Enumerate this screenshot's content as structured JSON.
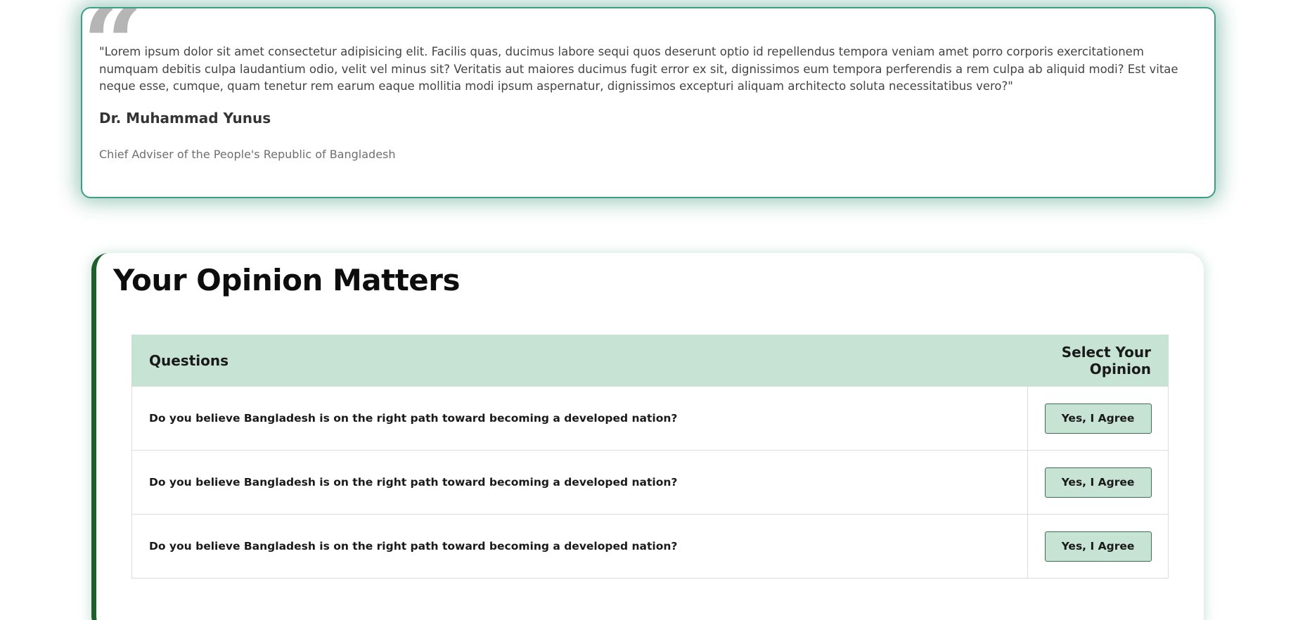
{
  "quote": {
    "icon": "quote-icon",
    "mark": "“",
    "text": "\"Lorem ipsum dolor sit amet consectetur adipisicing elit. Facilis quas, ducimus labore sequi quos deserunt optio id repellendus tempora veniam amet porro corporis exercitationem numquam debitis culpa laudantium odio, velit vel minus sit? Veritatis aut maiores ducimus fugit error ex sit, dignissimos eum tempora perferendis a rem culpa ab aliquid modi? Est vitae neque esse, cumque, quam tenetur rem earum eaque mollitia modi ipsum aspernatur, dignissimos excepturi aliquam architecto soluta necessitatibus vero?\"",
    "author": "Dr. Muhammad Yunus",
    "role": "Chief Adviser of the People's Republic of Bangladesh"
  },
  "opinion": {
    "title": "Your Opinion Matters",
    "columns": {
      "questions": "Questions",
      "opinion": "Select Your Opinion"
    },
    "rows": [
      {
        "question": "Do you believe Bangladesh is on the right path toward becoming a developed nation?",
        "button": "Yes, I Agree"
      },
      {
        "question": "Do you believe Bangladesh is on the right path toward becoming a developed nation?",
        "button": "Yes, I Agree"
      },
      {
        "question": "Do you believe Bangladesh is on the right path toward becoming a developed nation?",
        "button": "Yes, I Agree"
      }
    ]
  },
  "colors": {
    "accent_green": "#1f5f2c",
    "light_green": "#c6e3d4",
    "card_border": "#3f9d86"
  }
}
